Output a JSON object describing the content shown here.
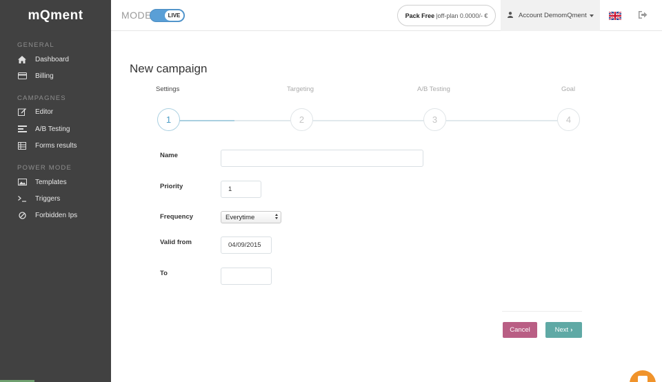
{
  "sidebar": {
    "logo": "mQment",
    "sections": [
      {
        "title": "GENERAL",
        "items": [
          {
            "label": "Dashboard",
            "icon": "home-icon"
          },
          {
            "label": "Billing",
            "icon": "credit-card-icon"
          }
        ]
      },
      {
        "title": "CAMPAGNES",
        "items": [
          {
            "label": "Editor",
            "icon": "edit-icon"
          },
          {
            "label": "A/B Testing",
            "icon": "ab-testing-icon"
          },
          {
            "label": "Forms results",
            "icon": "table-icon"
          }
        ]
      },
      {
        "title": "POWER MODE",
        "items": [
          {
            "label": "Templates",
            "icon": "image-icon"
          },
          {
            "label": "Triggers",
            "icon": "terminal-icon"
          },
          {
            "label": "Forbidden Ips",
            "icon": "ban-icon"
          }
        ]
      }
    ]
  },
  "header": {
    "mode_label": "MODE",
    "toggle_label": "LIVE",
    "pack_name": "Pack Free",
    "pack_detail": "|off-plan 0.0000/- €",
    "account_label": "Account DemomQment",
    "flag_icon": "uk-flag-icon",
    "logout_icon": "logout-icon"
  },
  "main": {
    "title": "New campaign",
    "steps": [
      {
        "label": "Settings",
        "number": "1",
        "active": true
      },
      {
        "label": "Targeting",
        "number": "2",
        "active": false
      },
      {
        "label": "A/B Testing",
        "number": "3",
        "active": false
      },
      {
        "label": "Goal",
        "number": "4",
        "active": false
      }
    ],
    "form": {
      "name_label": "Name",
      "name_value": "",
      "priority_label": "Priority",
      "priority_value": "1",
      "frequency_label": "Frequency",
      "frequency_value": "Everytime",
      "valid_from_label": "Valid from",
      "valid_from_value": "04/09/2015",
      "to_label": "To",
      "to_value": ""
    },
    "buttons": {
      "cancel": "Cancel",
      "next": "Next"
    }
  },
  "colors": {
    "sidebar_bg": "#414141",
    "accent_blue": "#5a9fd6",
    "cancel": "#b95e84",
    "next": "#5fa9a5",
    "help": "#f0932b"
  }
}
